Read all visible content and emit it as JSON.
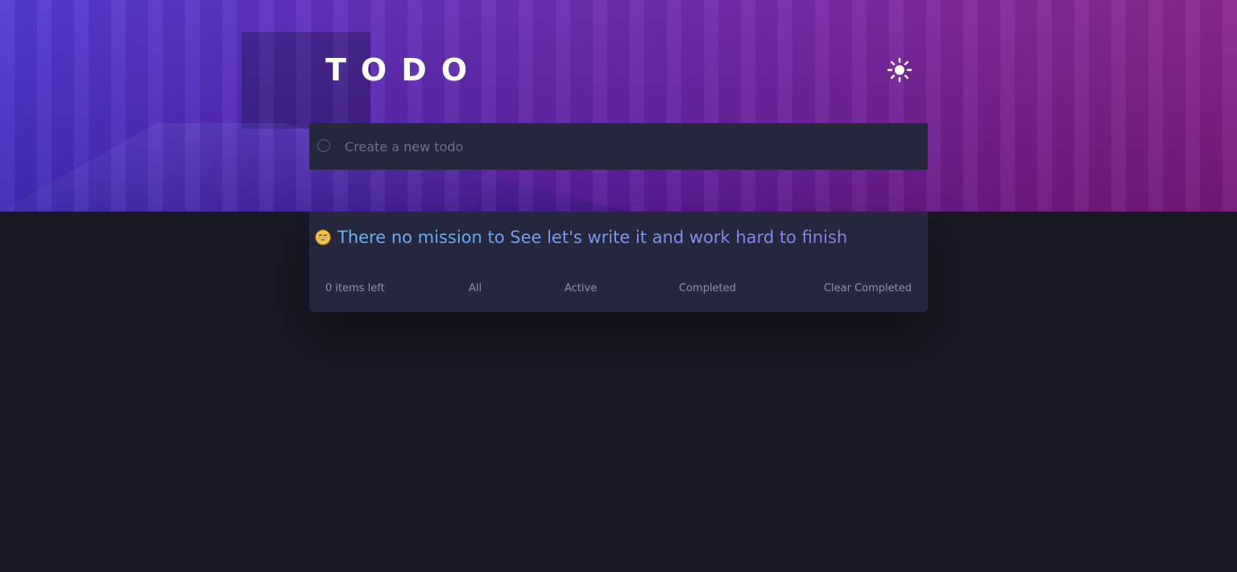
{
  "header": {
    "title": "TODO",
    "theme_toggle_icon": "sun-icon"
  },
  "new_todo": {
    "placeholder": "Create a new todo",
    "value": ""
  },
  "list": {
    "empty_icon": "grinning-face-icon",
    "empty_message": "There no mission to See let's write it and work hard to finish"
  },
  "footer": {
    "items_left": "0 items left",
    "filters": {
      "all": "All",
      "active": "Active",
      "completed": "Completed"
    },
    "clear_completed": "Clear Completed"
  },
  "colors": {
    "background": "#181923",
    "card": "#25273c",
    "gradient_start": "#4b2fd1",
    "gradient_end": "#851c86",
    "empty_message_start": "#5fb6ff",
    "empty_message_end": "#8a7cf0"
  }
}
